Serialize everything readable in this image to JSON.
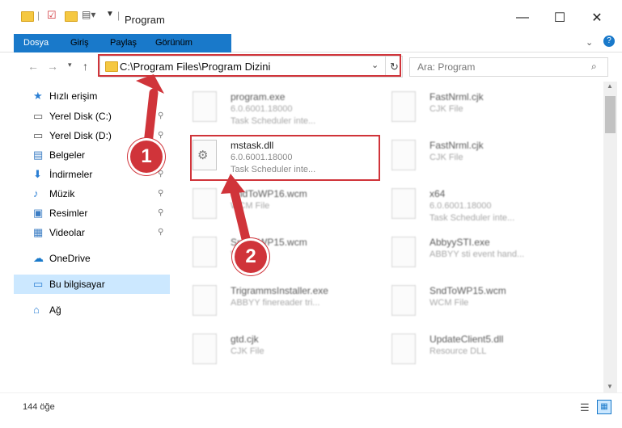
{
  "window": {
    "title": "Program",
    "minimize": "—",
    "maximize": "☐",
    "close": "✕",
    "help": "?"
  },
  "ribbon": {
    "tabs": [
      "Dosya",
      "Giriş",
      "Paylaş",
      "Görünüm"
    ]
  },
  "nav": {
    "address": "C:\\Program Files\\Program Dizini",
    "search_placeholder": "Ara: Program"
  },
  "sidebar": {
    "items": [
      {
        "label": "Hızlı erişim",
        "icon": "star-icon"
      },
      {
        "label": "Yerel Disk (C:)",
        "icon": "drive-icon",
        "pinned": true
      },
      {
        "label": "Yerel Disk (D:)",
        "icon": "drive-icon",
        "pinned": true
      },
      {
        "label": "Belgeler",
        "icon": "documents-icon",
        "pinned": true
      },
      {
        "label": "İndirmeler",
        "icon": "download-icon",
        "pinned": true
      },
      {
        "label": "Müzik",
        "icon": "music-icon",
        "pinned": true
      },
      {
        "label": "Resimler",
        "icon": "pictures-icon",
        "pinned": true
      },
      {
        "label": "Videolar",
        "icon": "videos-icon",
        "pinned": true
      },
      {
        "label": "OneDrive",
        "icon": "cloud-icon"
      },
      {
        "label": "Bu bilgisayar",
        "icon": "computer-icon",
        "selected": true
      },
      {
        "label": "Ağ",
        "icon": "network-icon"
      }
    ]
  },
  "files": {
    "left": [
      {
        "name": "program.exe",
        "l1": "6.0.6001.18000",
        "l2": "Task Scheduler inte..."
      },
      {
        "name": "mstask.dll",
        "l1": "6.0.6001.18000",
        "l2": "Task Scheduler inte..."
      },
      {
        "name": "SndToWP16.wcm",
        "l1": "WCM File",
        "l2": ""
      },
      {
        "name": "SndToWP15.wcm",
        "l1": "WCM File",
        "l2": ""
      },
      {
        "name": "TrigrammsInstaller.exe",
        "l1": "ABBYY finereader tri...",
        "l2": ""
      },
      {
        "name": "gtd.cjk",
        "l1": "CJK File",
        "l2": ""
      }
    ],
    "right": [
      {
        "name": "FastNrml.cjk",
        "l1": "CJK File",
        "l2": ""
      },
      {
        "name": "FastNrml.cjk",
        "l1": "CJK File",
        "l2": ""
      },
      {
        "name": "x64",
        "l1": "6.0.6001.18000",
        "l2": "Task Scheduler inte..."
      },
      {
        "name": "AbbyySTI.exe",
        "l1": "ABBYY sti event hand...",
        "l2": ""
      },
      {
        "name": "SndToWP15.wcm",
        "l1": "WCM File",
        "l2": ""
      },
      {
        "name": "UpdateClient5.dll",
        "l1": "Resource DLL",
        "l2": ""
      }
    ]
  },
  "status": {
    "count": "144 öğe"
  },
  "markers": {
    "one": "1",
    "two": "2"
  },
  "colors": {
    "accent": "#1979ca",
    "highlight": "#d0343a",
    "selected": "#cce8ff"
  }
}
